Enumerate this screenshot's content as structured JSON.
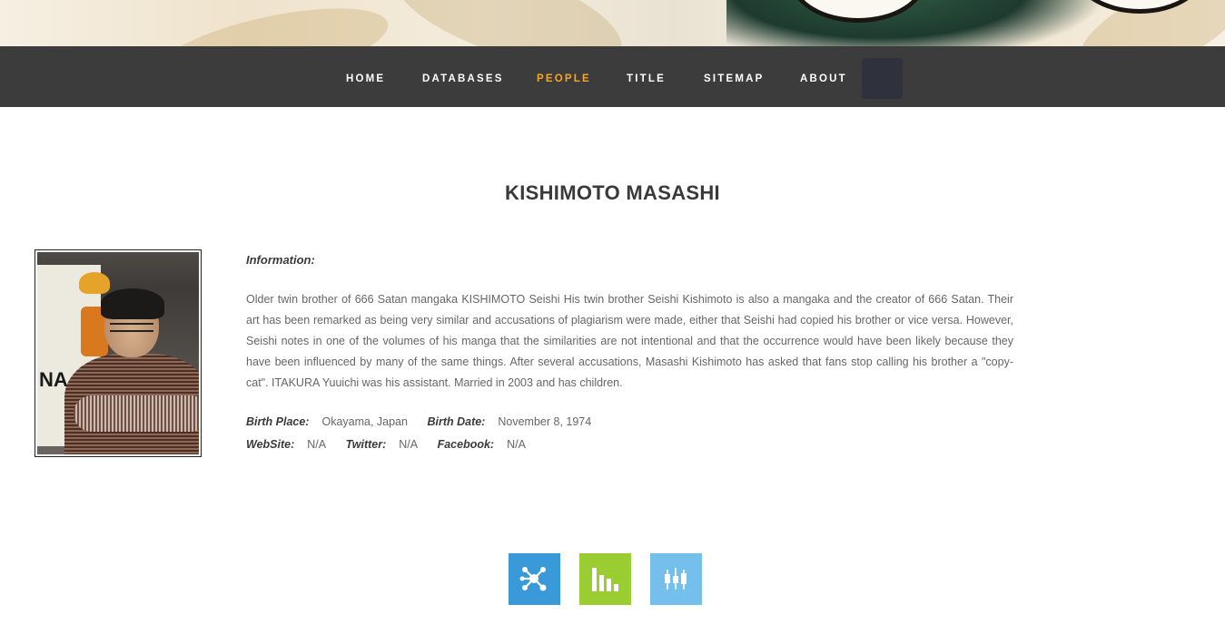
{
  "nav": {
    "items": [
      {
        "label": "HOME",
        "active": false
      },
      {
        "label": "DATABASES",
        "active": false
      },
      {
        "label": "PEOPLE",
        "active": true
      },
      {
        "label": "TITLE",
        "active": false
      },
      {
        "label": "SITEMAP",
        "active": false
      },
      {
        "label": "ABOUT",
        "active": false
      }
    ],
    "active_color": "#f5a623",
    "bar_color": "#3c3c3c"
  },
  "person": {
    "name": "KISHIMOTO MASASHI",
    "photo_alt": "Kishimoto Masashi photo",
    "info_label": "Information:",
    "bio": "Older twin brother of 666 Satan mangaka KISHIMOTO Seishi His twin brother Seishi Kishimoto is also a mangaka and the creator of 666 Satan. Their art has been remarked as being very similar and accusations of plagiarism were made, either that Seishi had copied his brother or vice versa. However, Seishi notes in one of the volumes of his manga that the similarities are not intentional and that the occurrence would have been likely because they have been influenced by many of the same things. After several accusations, Masashi Kishimoto has asked that fans stop calling his brother a \"copy-cat\". ITAKURA Yuuichi was his assistant. Married in 2003 and has children.",
    "birth_place_label": "Birth Place:",
    "birth_place": "Okayama, Japan",
    "birth_date_label": "Birth Date:",
    "birth_date": "November 8, 1974",
    "website_label": "WebSite:",
    "website": "N/A",
    "twitter_label": "Twitter:",
    "twitter": "N/A",
    "facebook_label": "Facebook:",
    "facebook": "N/A"
  },
  "tiles": [
    {
      "icon": "network-icon",
      "color": "#3a9ad9"
    },
    {
      "icon": "bar-chart-icon",
      "color": "#9acd32"
    },
    {
      "icon": "candlestick-icon",
      "color": "#74bfec"
    }
  ]
}
